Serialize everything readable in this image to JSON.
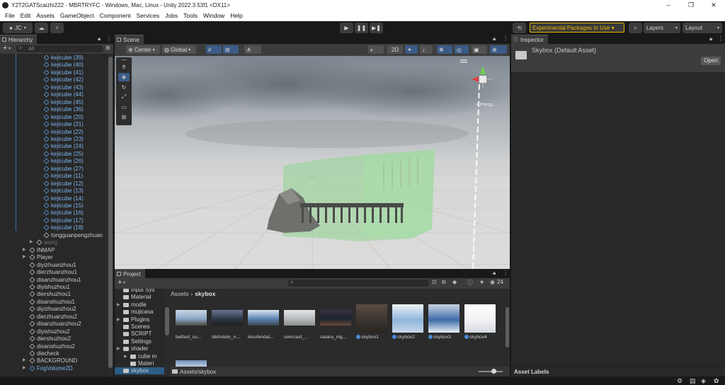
{
  "window": {
    "title": "Y2T2GATScaizhi222 - MBRTRYFC - Windows, Mac, Linux - Unity 2022.3.53f1 <DX11>",
    "controls": [
      "–",
      "❐",
      "✕"
    ]
  },
  "menu": [
    "File",
    "Edit",
    "Assets",
    "GameObject",
    "Component",
    "Services",
    "Jobs",
    "Tools",
    "Window",
    "Help"
  ],
  "toolbar": {
    "account": "JC",
    "experimental": "Experimental Packages In Use ▾",
    "layers": "Layers",
    "layout": "Layout"
  },
  "hierarchy": {
    "tab": "Hierarchy",
    "search_placeholder": "All",
    "rows": [
      {
        "label": "kejicube (39)",
        "indent": 62,
        "blue": true
      },
      {
        "label": "kejicube (40)",
        "indent": 62,
        "blue": true
      },
      {
        "label": "kejicube (41)",
        "indent": 62,
        "blue": true
      },
      {
        "label": "kejicube (42)",
        "indent": 62,
        "blue": true
      },
      {
        "label": "kejicube (43)",
        "indent": 62,
        "blue": true
      },
      {
        "label": "kejicube (44)",
        "indent": 62,
        "blue": true
      },
      {
        "label": "kejicube (45)",
        "indent": 62,
        "blue": true
      },
      {
        "label": "kejicube (36)",
        "indent": 62,
        "blue": true
      },
      {
        "label": "kejicube (20)",
        "indent": 62,
        "blue": true
      },
      {
        "label": "kejicube (21)",
        "indent": 62,
        "blue": true
      },
      {
        "label": "kejicube (22)",
        "indent": 62,
        "blue": true
      },
      {
        "label": "kejicube (23)",
        "indent": 62,
        "blue": true
      },
      {
        "label": "kejicube (24)",
        "indent": 62,
        "blue": true
      },
      {
        "label": "kejicube (25)",
        "indent": 62,
        "blue": true
      },
      {
        "label": "kejicube (26)",
        "indent": 62,
        "blue": true
      },
      {
        "label": "kejicube (27)",
        "indent": 62,
        "blue": true
      },
      {
        "label": "kejicube (11)",
        "indent": 62,
        "blue": true
      },
      {
        "label": "kejicube (12)",
        "indent": 62,
        "blue": true
      },
      {
        "label": "kejicube (13)",
        "indent": 62,
        "blue": true
      },
      {
        "label": "kejicube (14)",
        "indent": 62,
        "blue": true
      },
      {
        "label": "kejicube (15)",
        "indent": 62,
        "blue": true
      },
      {
        "label": "kejicube (16)",
        "indent": 62,
        "blue": true
      },
      {
        "label": "kejicube (17)",
        "indent": 62,
        "blue": true
      },
      {
        "label": "kejicube (18)",
        "indent": 62,
        "blue": true
      },
      {
        "label": "tongguanpengzhuan",
        "indent": 62,
        "blue": false
      },
      {
        "label": "wang",
        "indent": 52,
        "blue": false,
        "dim": true,
        "arrow": true
      },
      {
        "label": "INMAP",
        "indent": 42,
        "blue": false,
        "arrow": true
      },
      {
        "label": "Player",
        "indent": 42,
        "blue": false,
        "arrow": true
      },
      {
        "label": "diyizhuanzhou1",
        "indent": 42,
        "blue": false
      },
      {
        "label": "dierzhuanzhou1",
        "indent": 42,
        "blue": false
      },
      {
        "label": "disanzhuanzhou1",
        "indent": 42,
        "blue": false
      },
      {
        "label": "diyishuzhou1",
        "indent": 42,
        "blue": false
      },
      {
        "label": "diershuzhou1",
        "indent": 42,
        "blue": false
      },
      {
        "label": "disanshuzhou1",
        "indent": 42,
        "blue": false
      },
      {
        "label": "diyizhuanzhou2",
        "indent": 42,
        "blue": false
      },
      {
        "label": "dierzhuanzhou2",
        "indent": 42,
        "blue": false
      },
      {
        "label": "disanzhuanzhou2",
        "indent": 42,
        "blue": false
      },
      {
        "label": "diyishuzhou2",
        "indent": 42,
        "blue": false
      },
      {
        "label": "diershuzhou2",
        "indent": 42,
        "blue": false
      },
      {
        "label": "disanshuzhou2",
        "indent": 42,
        "blue": false
      },
      {
        "label": "diecheck",
        "indent": 42,
        "blue": false
      },
      {
        "label": "BACKGROUND",
        "indent": 42,
        "blue": false,
        "arrow": true
      },
      {
        "label": "FogVolume2D",
        "indent": 42,
        "blue": true,
        "arrow": true
      }
    ]
  },
  "scene": {
    "tab": "Scene",
    "pivot": "Center",
    "space": "Global",
    "mode2d": "2D",
    "gizmo_persp": "< Persp"
  },
  "inspector": {
    "tab": "Inspector",
    "title": "Skybox (Default Asset)",
    "open_btn": "Open",
    "asset_labels": "Asset Labels"
  },
  "project": {
    "tab": "Project",
    "count": "24",
    "breadcrumb_root": "Assets",
    "breadcrumb_leaf": "skybox",
    "path": "Assets/skybox",
    "tree": [
      {
        "label": "Input Sys",
        "indent": 12
      },
      {
        "label": "Material",
        "indent": 12
      },
      {
        "label": "modle",
        "indent": 12,
        "arrow": true
      },
      {
        "label": "mujicasa",
        "indent": 12
      },
      {
        "label": "Plugins",
        "indent": 12,
        "arrow": true
      },
      {
        "label": "Scenes",
        "indent": 12
      },
      {
        "label": "SCRIPT",
        "indent": 12
      },
      {
        "label": "Settings",
        "indent": 12
      },
      {
        "label": "shader",
        "indent": 12,
        "arrow": true
      },
      {
        "label": "cube m",
        "indent": 22,
        "arrow": true
      },
      {
        "label": "Materi",
        "indent": 22
      },
      {
        "label": "skybox",
        "indent": 12,
        "selected": true
      }
    ],
    "assets": [
      {
        "label": "belfast_su...",
        "kind": "hdr",
        "colors": [
          "#8ea9c9",
          "#c9d6e6",
          "#4c4a40"
        ]
      },
      {
        "label": "dikhololo_n...",
        "kind": "hdr",
        "colors": [
          "#2f3a4a",
          "#6d7890",
          "#1e1e1c"
        ]
      },
      {
        "label": "kloofendal...",
        "kind": "hdr",
        "colors": [
          "#5f87b8",
          "#dde6f2",
          "#3c4650"
        ]
      },
      {
        "label": "overcast_...",
        "kind": "hdr",
        "colors": [
          "#b9bcc0",
          "#e4e6e8",
          "#8c8f8f"
        ]
      },
      {
        "label": "satara_nig...",
        "kind": "hdr",
        "colors": [
          "#1c2230",
          "#3b3240",
          "#6a4a3a"
        ]
      },
      {
        "label": "skybox1",
        "kind": "mat",
        "colors": [
          "#3a3430",
          "#5b4c42",
          "#2a2622"
        ]
      },
      {
        "label": "skybox2",
        "kind": "mat",
        "colors": [
          "#8fb5dc",
          "#f0f3f8",
          "#c8d8ea"
        ]
      },
      {
        "label": "skybox3",
        "kind": "mat",
        "colors": [
          "#3f6ca8",
          "#c9d5e4",
          "#e8eef5"
        ]
      },
      {
        "label": "skybox4",
        "kind": "mat",
        "colors": [
          "#f2f2f4",
          "#ffffff",
          "#d5d9de"
        ]
      }
    ]
  }
}
